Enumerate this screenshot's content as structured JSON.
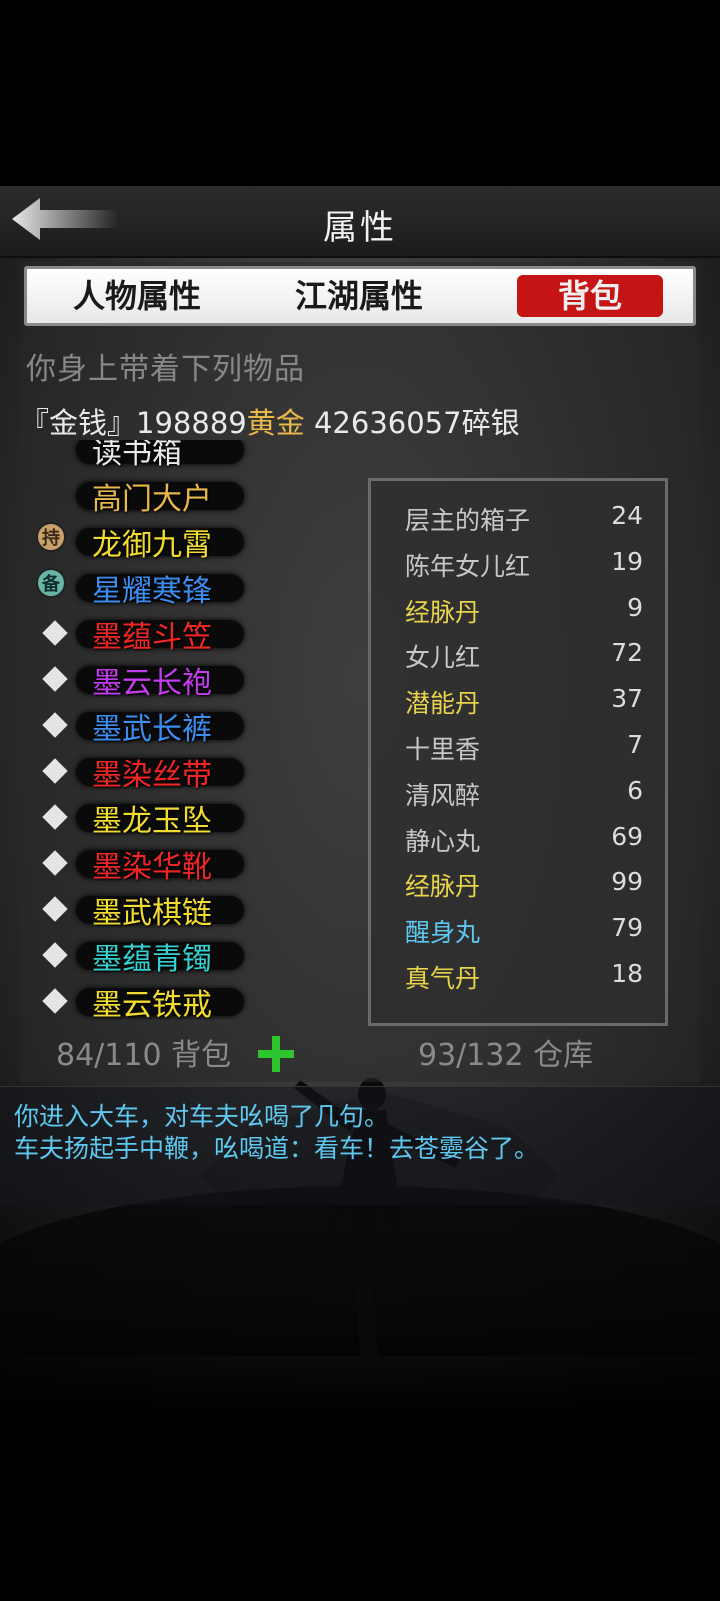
{
  "header": {
    "title": "属性"
  },
  "tabs": [
    {
      "label": "人物属性"
    },
    {
      "label": "江湖属性"
    },
    {
      "label": "背包",
      "active": true
    }
  ],
  "inventory": {
    "subtitle": "你身上带着下列物品",
    "money": {
      "prefix": "『金钱』",
      "gold_amount": "198889",
      "gold_label": "黄金",
      "silver_amount": " 42636057",
      "silver_label": "碎银"
    },
    "partial_top_item": "读书箱",
    "equipment": [
      {
        "name": "高门大户",
        "color": "#e9b84a",
        "marker": "none"
      },
      {
        "name": "龙御九霄",
        "color": "#f2dc30",
        "marker": "hold",
        "badge": "持"
      },
      {
        "name": "星耀寒锋",
        "color": "#3b8df0",
        "marker": "spare",
        "badge": "备"
      },
      {
        "name": "墨蕴斗笠",
        "color": "#f02626",
        "marker": "diamond"
      },
      {
        "name": "墨云长袍",
        "color": "#c43cf0",
        "marker": "diamond"
      },
      {
        "name": "墨武长裤",
        "color": "#3b8df0",
        "marker": "diamond"
      },
      {
        "name": "墨染丝带",
        "color": "#f02626",
        "marker": "diamond"
      },
      {
        "name": "墨龙玉坠",
        "color": "#f2dc30",
        "marker": "diamond"
      },
      {
        "name": "墨染华靴",
        "color": "#f02626",
        "marker": "diamond"
      },
      {
        "name": "墨武棋链",
        "color": "#f2dc30",
        "marker": "diamond"
      },
      {
        "name": "墨蕴青镯",
        "color": "#36d0d0",
        "marker": "diamond"
      },
      {
        "name": "墨云铁戒",
        "color": "#f2dc30",
        "marker": "diamond"
      }
    ],
    "items": [
      {
        "name": "层主的箱子",
        "count": "24",
        "color": "#c8c8c8"
      },
      {
        "name": "陈年女儿红",
        "count": "19",
        "color": "#c8c8c8"
      },
      {
        "name": "经脉丹",
        "count": "9",
        "color": "#e8d44a"
      },
      {
        "name": "女儿红",
        "count": "72",
        "color": "#c8c8c8"
      },
      {
        "name": "潜能丹",
        "count": "37",
        "color": "#e8d44a"
      },
      {
        "name": "十里香",
        "count": "7",
        "color": "#c8c8c8"
      },
      {
        "name": "清风醉",
        "count": "6",
        "color": "#c8c8c8"
      },
      {
        "name": "静心丸",
        "count": "69",
        "color": "#c8c8c8"
      },
      {
        "name": "经脉丹",
        "count": "99",
        "color": "#e8d44a"
      },
      {
        "name": "醒身丸",
        "count": "79",
        "color": "#5fc8f0"
      },
      {
        "name": "真气丹",
        "count": "18",
        "color": "#e8d44a"
      }
    ],
    "bag_capacity": "84/110 背包",
    "storage_capacity": "93/132 仓库"
  },
  "log": [
    "你进入大车，对车夫吆喝了几句。",
    "车夫扬起手中鞭，吆喝道：看车！去苍孁谷了。"
  ],
  "colors": {
    "active_tab": "#c41414",
    "gold": "#e9b84a",
    "log_text": "#5fc8f0",
    "plus_button": "#2ec62e"
  }
}
